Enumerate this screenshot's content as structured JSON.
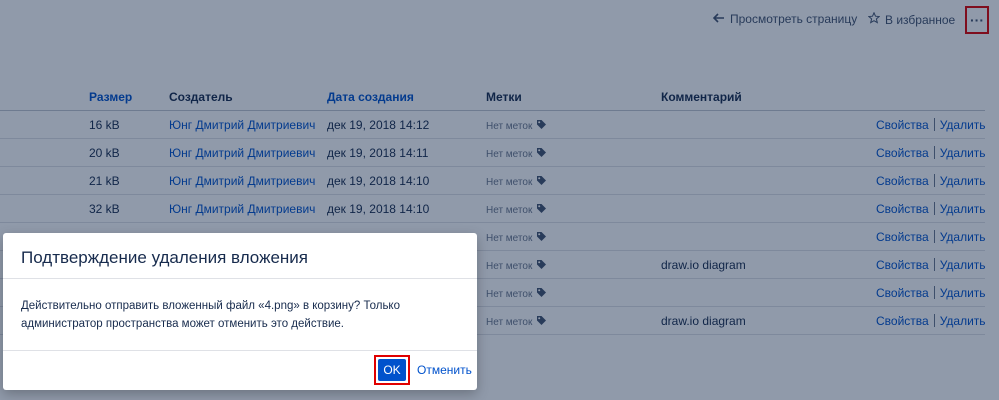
{
  "topbar": {
    "view_page_label": "Просмотреть страницу",
    "favorite_label": "В избранное",
    "more_label": "···"
  },
  "table": {
    "headers": {
      "size": "Размер",
      "creator": "Создатель",
      "created": "Дата создания",
      "labels": "Метки",
      "comment": "Комментарий"
    },
    "rows": [
      {
        "size": "16 kB",
        "creator": "Юнг Дмитрий Дмитриевич",
        "date": "дек 19, 2018 14:12",
        "labels": "Нет меток",
        "comment": ""
      },
      {
        "size": "20 kB",
        "creator": "Юнг Дмитрий Дмитриевич",
        "date": "дек 19, 2018 14:11",
        "labels": "Нет меток",
        "comment": ""
      },
      {
        "size": "21 kB",
        "creator": "Юнг Дмитрий Дмитриевич",
        "date": "дек 19, 2018 14:10",
        "labels": "Нет меток",
        "comment": ""
      },
      {
        "size": "32 kB",
        "creator": "Юнг Дмитрий Дмитриевич",
        "date": "дек 19, 2018 14:10",
        "labels": "Нет меток",
        "comment": ""
      },
      {
        "size": "",
        "creator": "",
        "date": "",
        "labels": "Нет меток",
        "comment": ""
      },
      {
        "size": "",
        "creator": "",
        "date": "",
        "labels": "Нет меток",
        "comment": "draw.io diagram"
      },
      {
        "size": "",
        "creator": "",
        "date": "",
        "labels": "Нет меток",
        "comment": ""
      },
      {
        "size": "",
        "creator": "",
        "date": "",
        "labels": "Нет меток",
        "comment": "draw.io diagram"
      }
    ],
    "actions": {
      "properties": "Свойства",
      "delete": "Удалить"
    }
  },
  "dialog": {
    "title": "Подтверждение удаления вложения",
    "body": "Действительно отправить вложенный файл «4.png» в корзину? Только администратор пространства может отменить это действие.",
    "ok_label": "OK",
    "cancel_label": "Отменить"
  },
  "colors": {
    "link": "#0052cc",
    "primary": "#0052cc",
    "highlight": "#e00000",
    "overlay": "#091e42"
  }
}
